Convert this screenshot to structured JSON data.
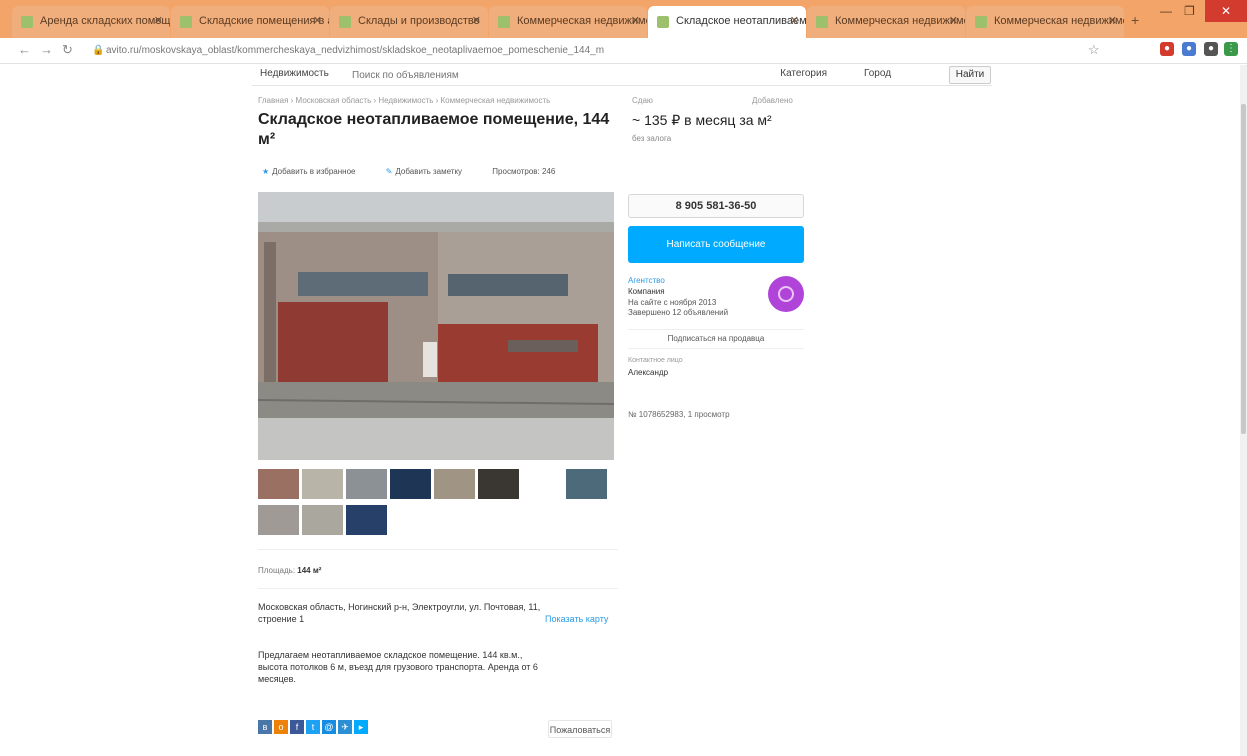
{
  "browser": {
    "tabs": [
      {
        "title": "Аренда складских помещений",
        "active": false
      },
      {
        "title": "Складские помещения в аренду",
        "active": false
      },
      {
        "title": "Склады и производство",
        "active": false
      },
      {
        "title": "Коммерческая недвижимость",
        "active": false
      },
      {
        "title": "Складское неотапливаемое",
        "active": true
      },
      {
        "title": "Коммерческая недвижимость",
        "active": false
      },
      {
        "title": "Коммерческая недвижимость",
        "active": false
      }
    ],
    "new_tab": "+",
    "url": "avito.ru/moskovskaya_oblast/kommercheskaya_nedvizhimost/skladskoe_neotaplivaemoe_pomeschenie_144_m"
  },
  "site": {
    "brand": "Недвижимость",
    "search_placeholder": "Поиск по объявлениям",
    "category": "Категория",
    "city": "Город",
    "find_label": "Найти"
  },
  "breadcrumb": "Главная › Московская область › Недвижимость › Коммерческая недвижимость",
  "meta": {
    "left": "Сдаю",
    "right": "Добавлено"
  },
  "listing": {
    "title": "Складское неотапливаемое помещение, 144 м²",
    "price": "~ 135 ₽ в месяц за м²",
    "price_note": "без залога",
    "actions": [
      "Добавить в избранное",
      "Добавить заметку",
      "Просмотров: 246"
    ],
    "area_label": "Площадь:",
    "area_value": "144 м²",
    "address": "Московская область, Ногинский р-н, Электроугли, ул. Почтовая, 11, строение 1",
    "show_map": "Показать карту",
    "description": "Предлагаем неотапливаемое складское помещение. 144 кв.м., высота потолков 6 м, въезд для грузового транспорта. Аренда от 6 месяцев.",
    "report": "Пожаловаться"
  },
  "contact": {
    "phone": "8 905 581-36-50",
    "message_btn": "Написать сообщение",
    "seller_link": "Агентство",
    "seller_name": "Компания",
    "seller_info": "На сайте с ноября 2013\nЗавершено 12 объявлений",
    "subscribe": "Подписаться на продавца",
    "contact_label": "Контактное лицо",
    "contact_name": "Александр",
    "ad_number": "№ 1078652983, 1 просмотр"
  },
  "colors": {
    "accent": "#00aaff",
    "avatar": "#b044d9",
    "link": "#2b9be5"
  }
}
